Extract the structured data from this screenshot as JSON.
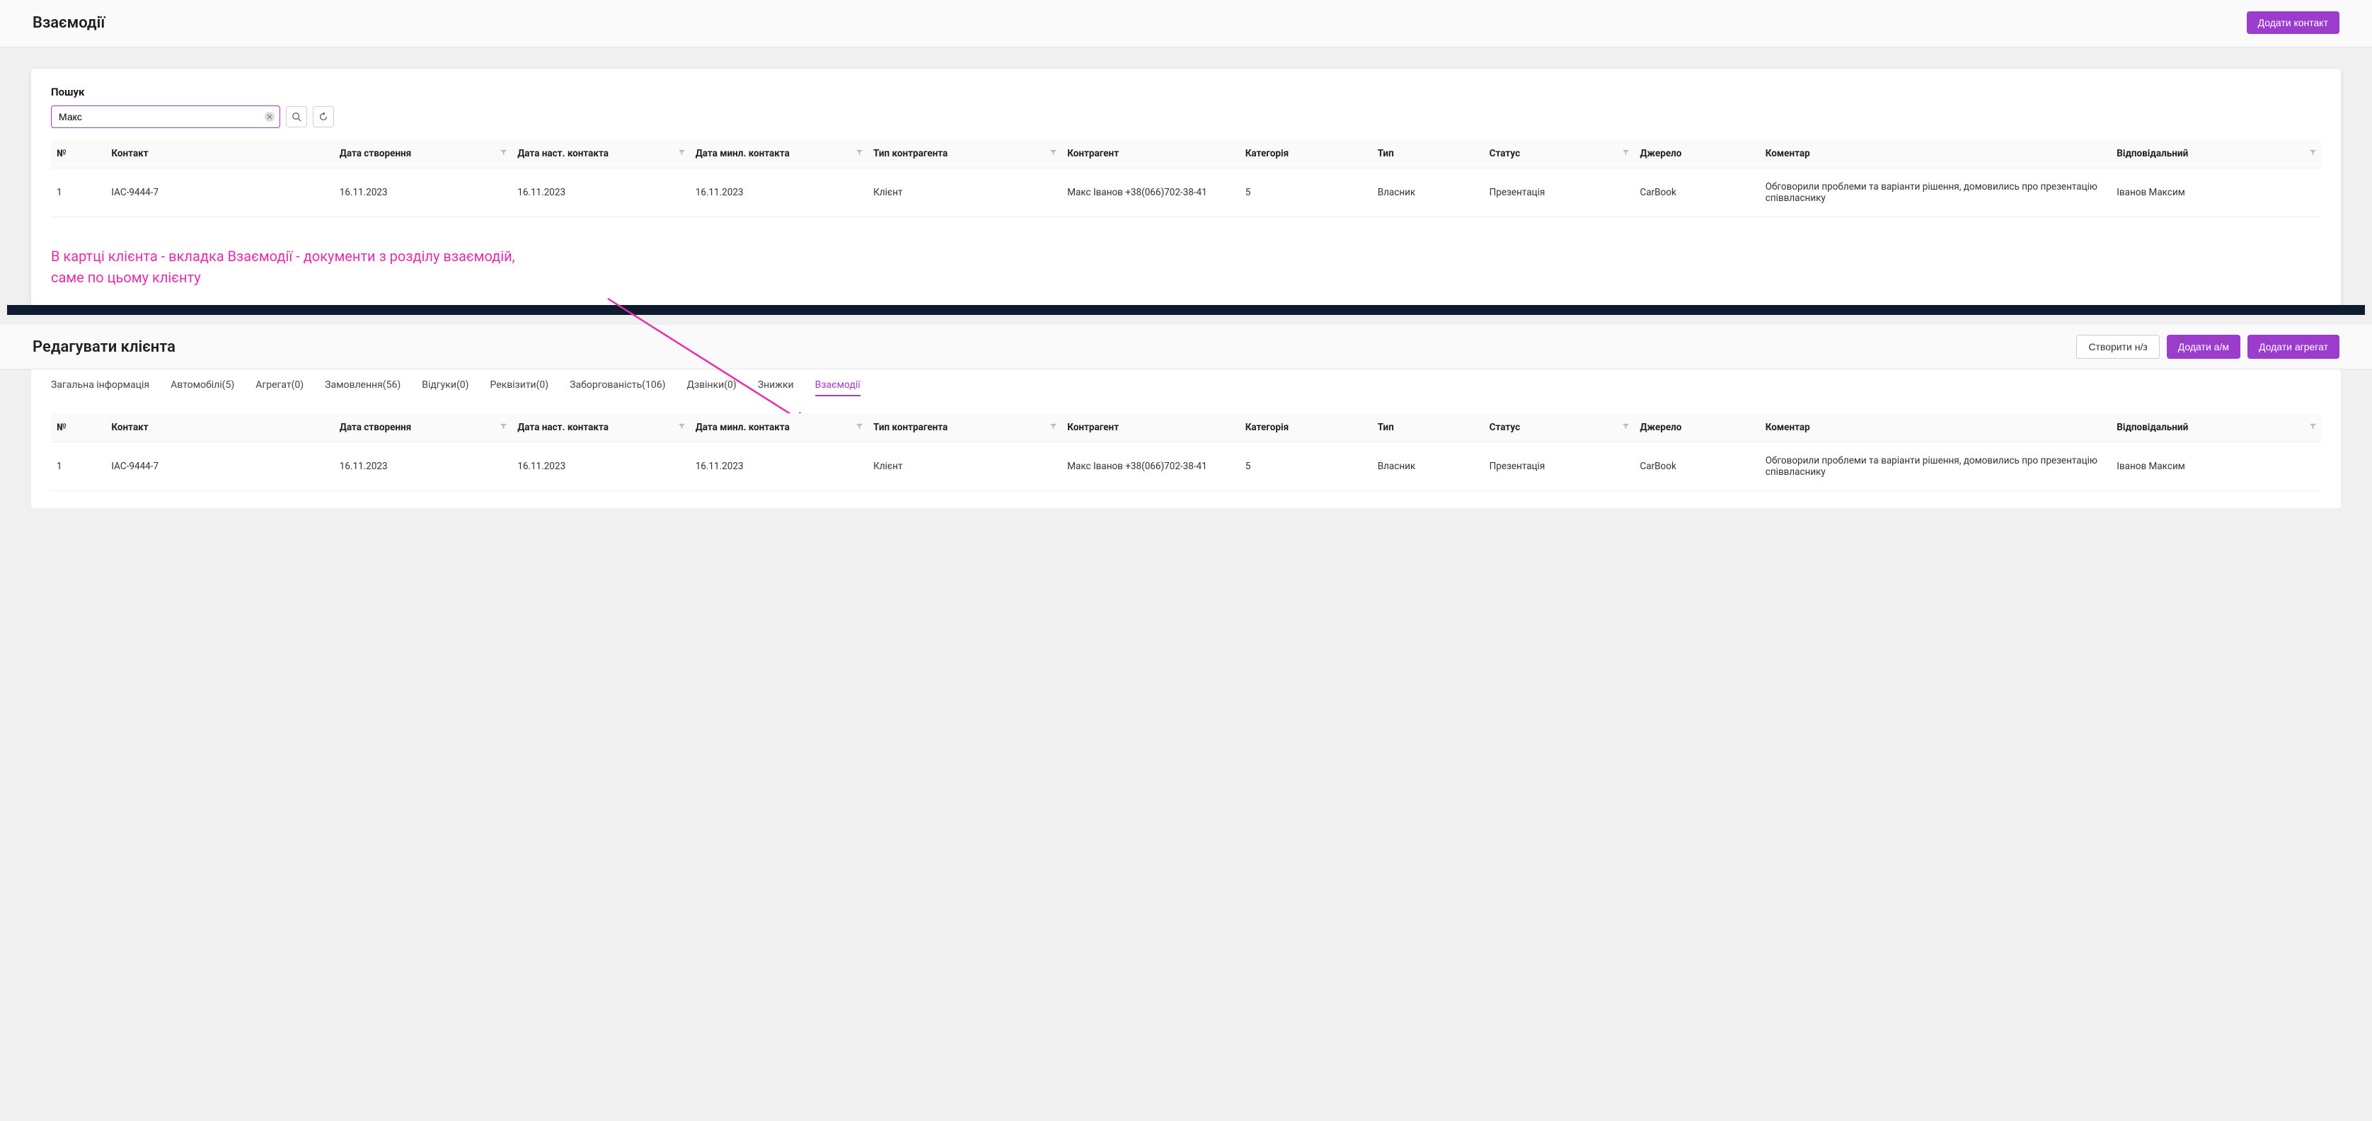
{
  "header1": {
    "title": "Взаємодії",
    "add_contact": "Додати контакт"
  },
  "search": {
    "label": "Пошук",
    "value": "Макс"
  },
  "columns": {
    "num": "№",
    "contact": "Контакт",
    "created": "Дата створення",
    "next_contact": "Дата наст. контакта",
    "last_contact": "Дата минл. контакта",
    "counterparty_type": "Тип контрагента",
    "counterparty": "Контрагент",
    "category": "Категорія",
    "type": "Тип",
    "status": "Статус",
    "source": "Джерело",
    "comment": "Коментар",
    "responsible": "Відповідальний"
  },
  "row1": {
    "num": "1",
    "contact": "IAC-9444-7",
    "created": "16.11.2023",
    "next_contact": "16.11.2023",
    "last_contact": "16.11.2023",
    "counterparty_type": "Клієнт",
    "counterparty": "Макс Іванов +38(066)702-38-41",
    "category": "5",
    "type": "Власник",
    "status": "Презентація",
    "source": "CarBook",
    "comment": "Обговорили проблеми та варіанти рішення, домовились про презентацію співвласнику",
    "responsible": "Іванов Максим"
  },
  "annotation": {
    "line1": "В картці клієнта - вкладка Взаємодії - документи з розділу взаємодій,",
    "line2": "саме по цьому клієнту"
  },
  "header2": {
    "title": "Редагувати клієнта",
    "create_order": "Створити н/з",
    "add_vehicle": "Додати а/м",
    "add_aggregate": "Додати агрегат"
  },
  "tabs": {
    "general": "Загальна інформація",
    "vehicles": "Автомобілі(5)",
    "aggregate": "Агрегат(0)",
    "orders": "Замовлення(56)",
    "reviews": "Відгуки(0)",
    "requisites": "Реквізити(0)",
    "debt": "Заборгованість(106)",
    "calls": "Дзвінки(0)",
    "discounts": "Знижки",
    "interactions": "Взаємодії"
  }
}
